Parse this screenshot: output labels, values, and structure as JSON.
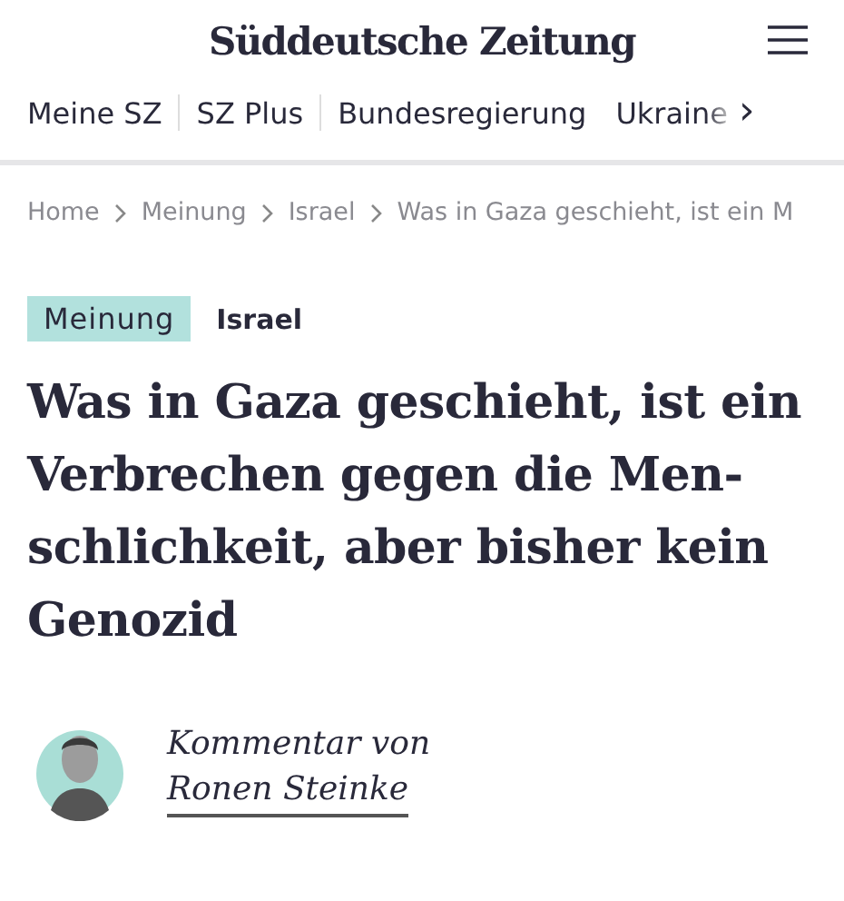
{
  "header": {
    "logo": "Süddeutsche Zeitung"
  },
  "nav": {
    "items": [
      {
        "label": "Meine SZ"
      },
      {
        "label": "SZ Plus"
      },
      {
        "label": "Bundesregierung"
      },
      {
        "label": "Ukraine"
      }
    ],
    "more": "›"
  },
  "breadcrumb": [
    "Home",
    "Meinung",
    "Israel",
    "Was in Gaza geschieht, ist ein M"
  ],
  "tags": {
    "category": "Meinung",
    "topic": "Israel"
  },
  "headline_lines": [
    "Was in Gaza geschieht, ist ein",
    "Verbrechen gegen die Men-",
    "schlichkeit, aber bisher kein",
    "Genozid"
  ],
  "author": {
    "intro": "Kommentar von",
    "name": "Ronen Steinke"
  }
}
